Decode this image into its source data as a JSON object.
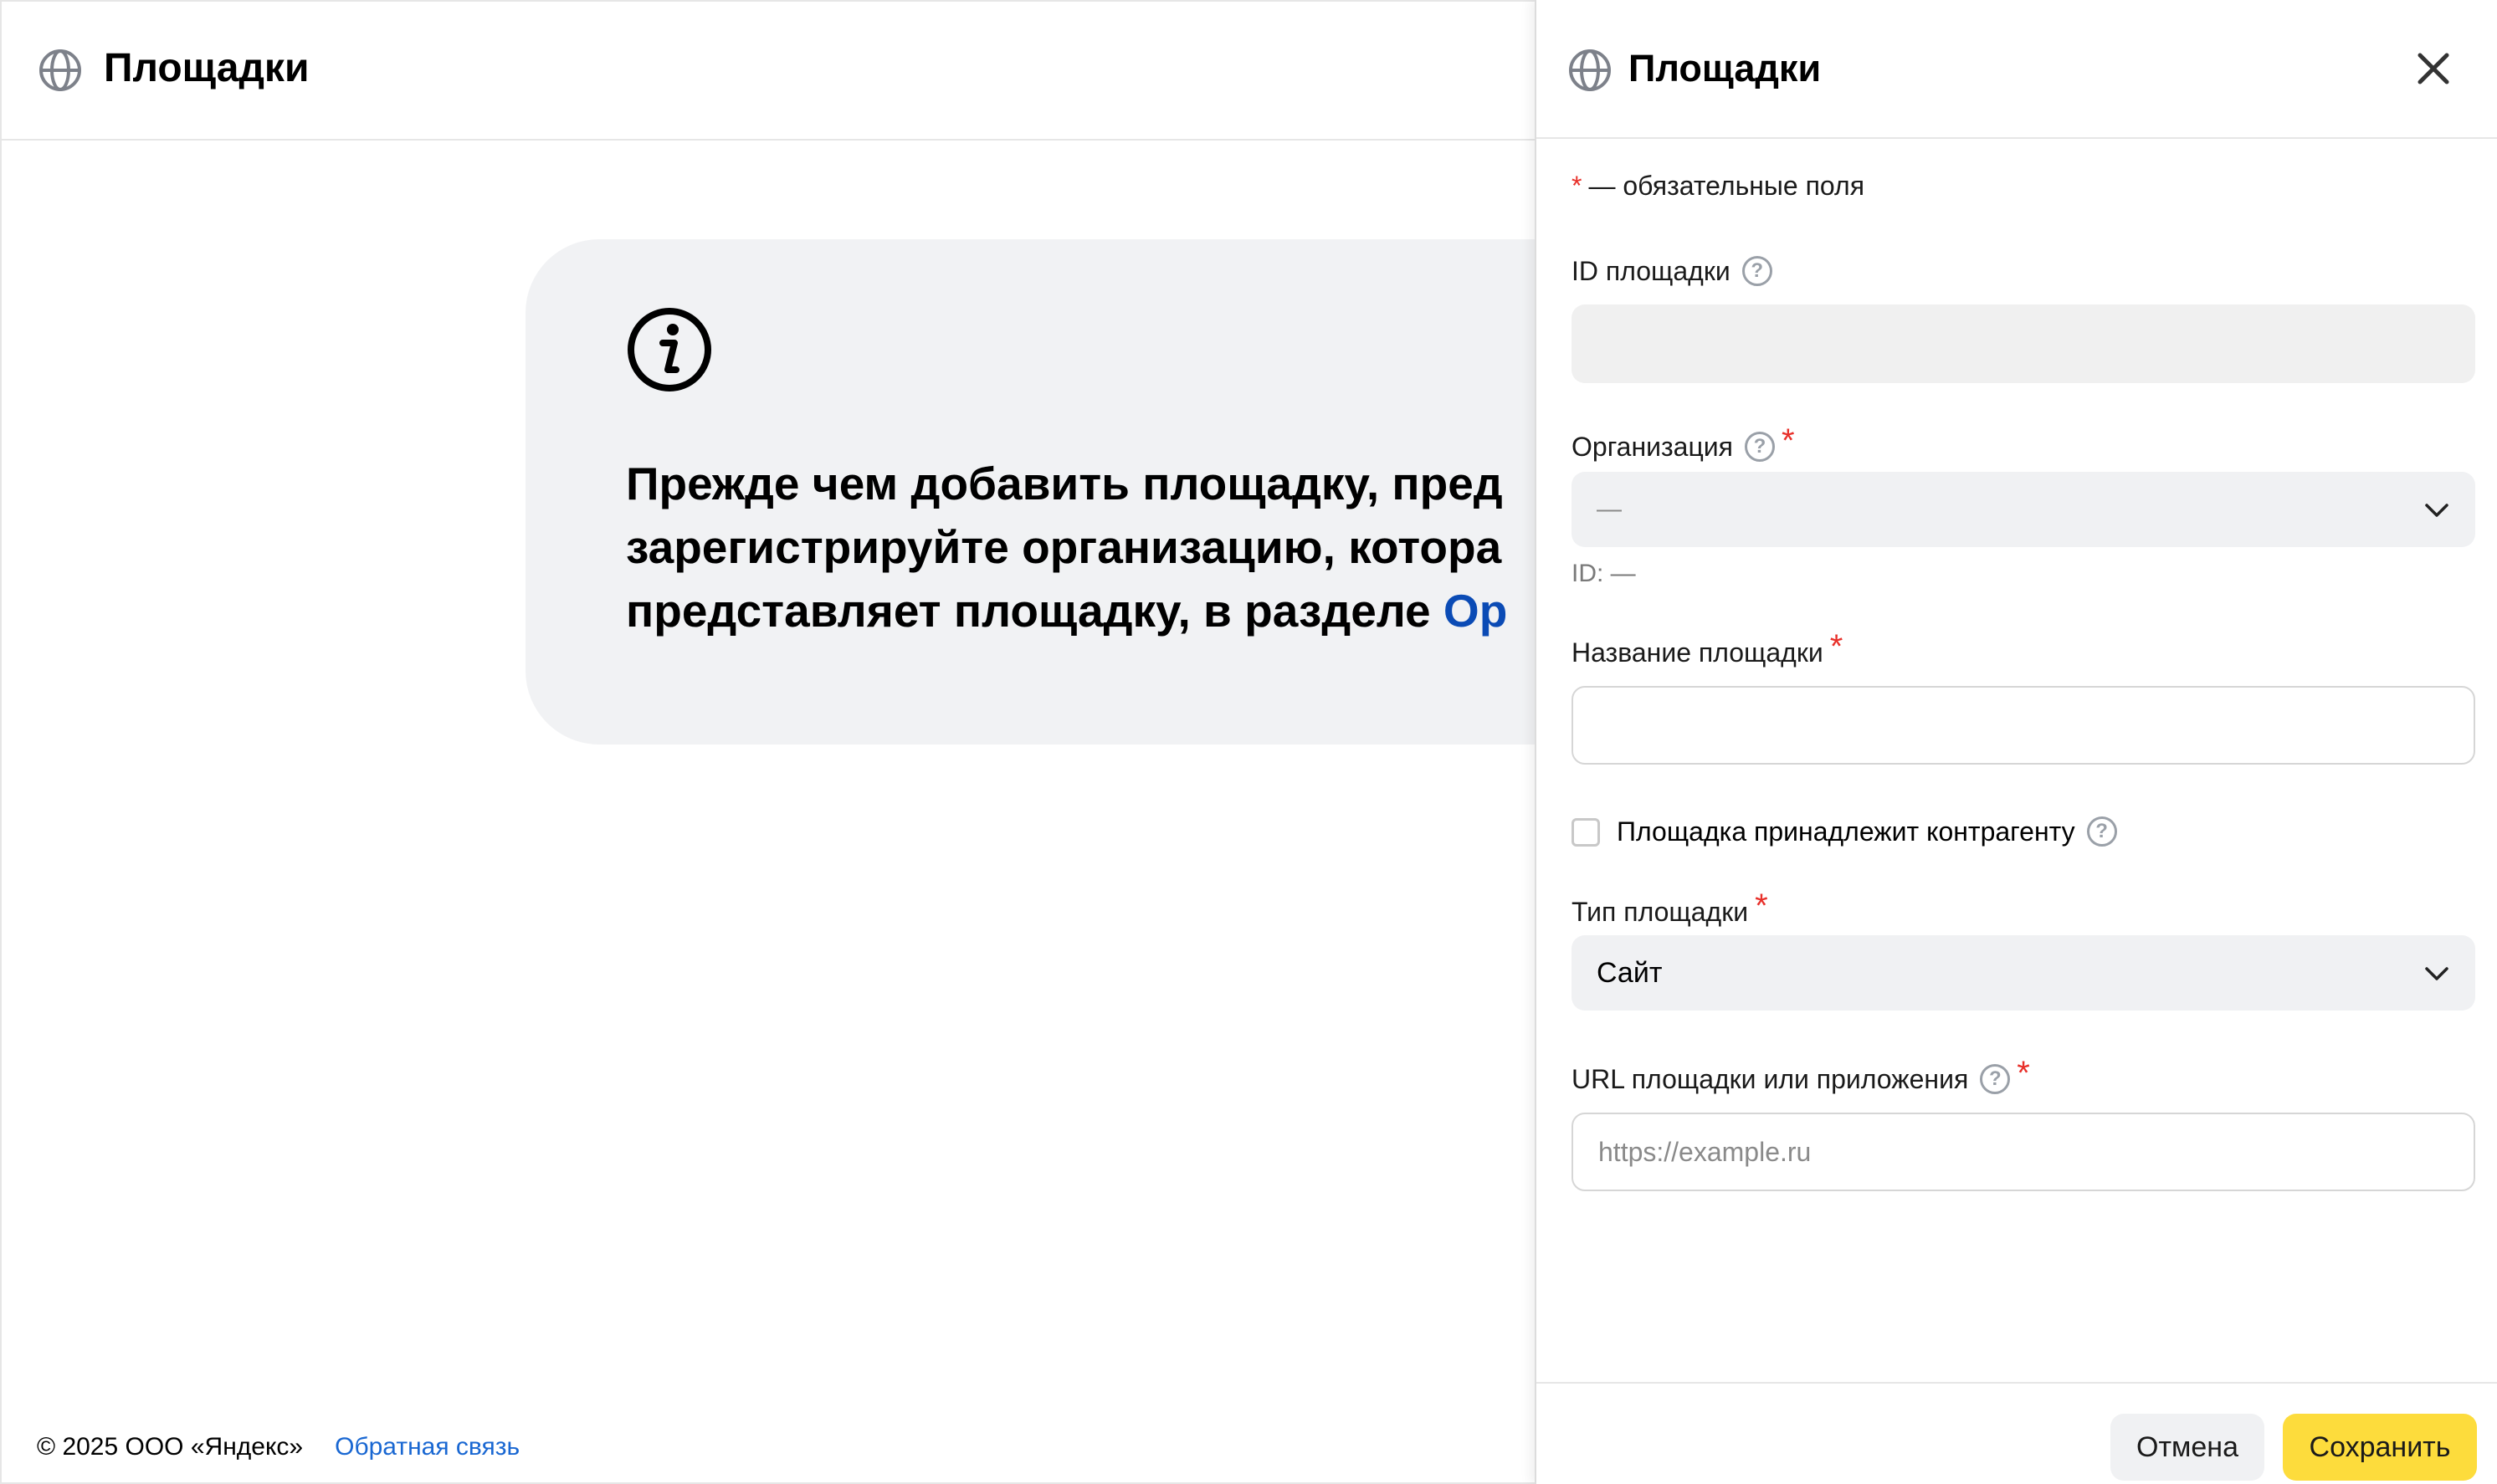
{
  "page": {
    "title": "Площадки",
    "info": {
      "text_line1": "Прежде чем добавить площадку, пред",
      "text_line2": "зарегистрируйте организацию, котора",
      "text_line3": "представляет площадку, в разделе ",
      "text_link": "Ор"
    },
    "footer": {
      "copyright": "© 2025 ООО «Яндекс»",
      "feedback": "Обратная связь"
    }
  },
  "panel": {
    "title": "Площадки",
    "required_note": "— обязательные поля",
    "required_star": "*",
    "fields": {
      "site_id": {
        "label": "ID площадки",
        "value": ""
      },
      "organization": {
        "label": "Организация",
        "value": "—",
        "id_note": "ID: —"
      },
      "site_name": {
        "label": "Название площадки",
        "value": ""
      },
      "belongs_counterparty": {
        "label": "Площадка принадлежит контрагенту",
        "checked": false
      },
      "site_type": {
        "label": "Тип площадки",
        "value": "Сайт"
      },
      "url": {
        "label": "URL площадки или приложения",
        "placeholder": "https://example.ru"
      }
    },
    "help_glyph": "?",
    "buttons": {
      "cancel": "Отмена",
      "save": "Сохранить"
    }
  },
  "colors": {
    "accent_yellow": "#fddc3c",
    "required_red": "#e8302a",
    "link_blue": "#0b4bb5",
    "card_bg": "#f1f2f4"
  },
  "icons": [
    "globe-icon",
    "info-icon",
    "close-icon",
    "help-icon",
    "chevron-down-icon"
  ]
}
